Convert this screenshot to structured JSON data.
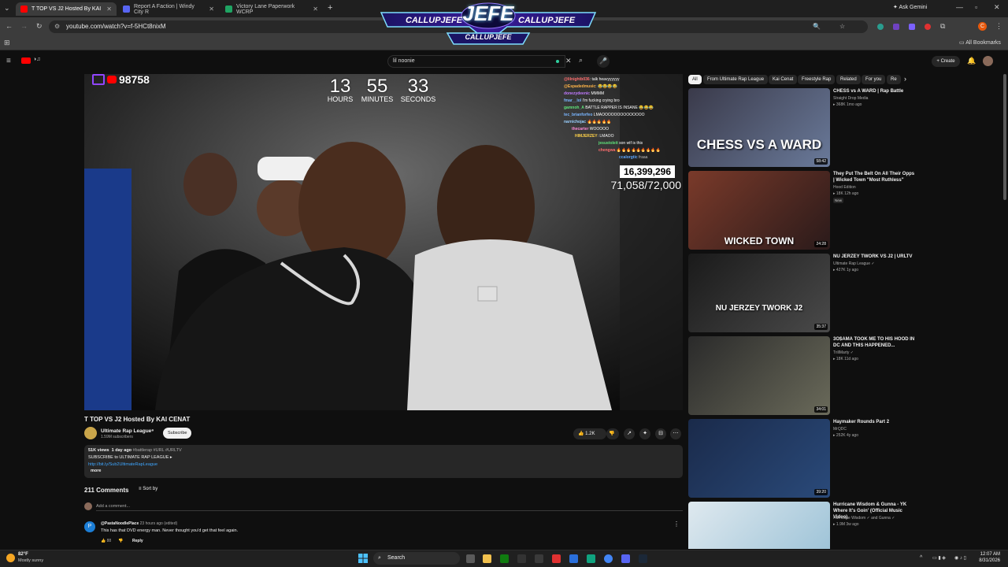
{
  "tabs": [
    {
      "title": "T TOP VS J2 Hosted By KAI",
      "favicon_color": "#ff0000",
      "active": true
    },
    {
      "title": "Report A Faction | Windy City R",
      "favicon_color": "#5865f2",
      "active": false
    },
    {
      "title": "Victory Lane Paperwork WCRP",
      "favicon_color": "#1fa463",
      "active": false
    }
  ],
  "browser": {
    "ask_gemini": "Ask Gemini",
    "url": "youtube.com/watch?v=f-5HCt8nixM",
    "all_bookmarks": "All Bookmarks"
  },
  "banner": {
    "main": "JEFE",
    "left": "CALLUPJEFE",
    "right": "CALLUPJEFE",
    "bottom": "CALLUPJEFE"
  },
  "youtube": {
    "search_value": "lil noonie",
    "create_label": "Create"
  },
  "stream": {
    "viewer_count": "98758",
    "timer": {
      "hours": "13",
      "minutes": "55",
      "seconds": "33",
      "hours_label": "HOURS",
      "minutes_label": "MINUTES",
      "seconds_label": "SECONDS"
    },
    "big_count": "16,399,296",
    "ratio": "71,058/72,000",
    "chat": [
      {
        "user": "@lilnightb036",
        "msg": "talk heavyyyyyy"
      },
      {
        "user": "@Espadedmusic",
        "msg": "😂😂😂😂"
      },
      {
        "user": "donezydeenic",
        "msg": "MMMM"
      },
      {
        "user": "fmar__lol",
        "msg": "I'm fucking crying bro"
      },
      {
        "user": "gamnoh_A",
        "msg": "BATTLE RAPPER IS INSANE 😂😂😂"
      },
      {
        "user": "tec_brianforfeo",
        "msg": "LMAOOOOOOOOOOOOOO"
      },
      {
        "user": "narnichojac",
        "msg": "🔥🔥🔥🔥🔥"
      },
      {
        "user": "thecarter",
        "msg": "WOOOOO"
      },
      {
        "user": "HIMJERZEY",
        "msg": "LMAOO"
      },
      {
        "user": "jesustoleit",
        "msg": "son wtf is this"
      },
      {
        "user": "chengwa",
        "msg": "🔥🔥🔥🔥🔥🔥🔥🔥🔥"
      },
      {
        "user": "ccalorgtic",
        "msg": "fraaa"
      }
    ]
  },
  "video": {
    "title": "T TOP VS J2 Hosted By KAI CENAT",
    "channel": "Ultimate Rap League",
    "subscribers": "1.59M subscribers",
    "subscribe_label": "Subscribe",
    "likes": "1.2K",
    "views": "51K views",
    "age": "1 day ago",
    "tags": "#battlerap #URL #URLTV",
    "desc_line": "SUBSCRIBE to ULTIMATE RAP LEAGUE ▸",
    "link": "http://bit.ly/Sub2UltimateRapLeague",
    "more": "more"
  },
  "comments": {
    "count_label": "211 Comments",
    "sort_label": "Sort by",
    "add_placeholder": "Add a comment...",
    "first": {
      "author": "@PastaNoodlePlace",
      "meta": "23 hours ago (edited)",
      "text": "This has that DVD energy man. Never thought you'd get that feel again.",
      "likes": "88",
      "reply": "Reply"
    }
  },
  "chips": [
    "All",
    "From Ultimate Rap League",
    "Kai Cenat",
    "Freestyle Rap",
    "Related",
    "For you",
    "Re"
  ],
  "recommendations": [
    {
      "title": "CHESS vs A WARD | Rap Battle",
      "channel": "Straight Drop Media",
      "meta": "▸ 368K  1mo ago",
      "duration": "58:42",
      "thumb_text": "CHESS VS A WARD",
      "color1": "#3a3a4a",
      "color2": "#6a7a9a"
    },
    {
      "title": "They Put The Belt On All Their Opps | Wicked Town \"Most Ruthless\"",
      "channel": "Hood Edition",
      "meta": "▸ 18K  12h ago",
      "badge": "New",
      "duration": "24:28",
      "thumb_text": "WICKED TOWN",
      "color1": "#7a3a2a",
      "color2": "#2a1a1a"
    },
    {
      "title": "NU JERZEY TWORK VS J2 | URLTV",
      "channel": "Ultimate Rap League ✓",
      "meta": "▸ 427K  1y ago",
      "duration": "35:37",
      "thumb_text": "NU JERZEY TWORK J2",
      "color1": "#1a1a1a",
      "color2": "#4a4a4a"
    },
    {
      "title": "3O$AMA TOOK ME TO HIS HOOD IN DC AND THIS HAPPENED...",
      "channel": "TrillMarty ✓",
      "meta": "▸ 18K  11d ago",
      "duration": "34:01",
      "thumb_text": "",
      "color1": "#2a2a2a",
      "color2": "#6a6a5a"
    },
    {
      "title": "Haymaker Rounds Part 2",
      "channel": "MrQDC",
      "meta": "▸ 252K  4y ago",
      "duration": "39:20",
      "thumb_text": "",
      "color1": "#1a2a4a",
      "color2": "#2a4a7a"
    },
    {
      "title": "Hurricane Wisdom & Gunna - YK Where It's Goin' (Official Music Video)",
      "channel": "Hurricane Wisdom ✓ and Gunna ✓",
      "meta": "▸ 1.9M  3w ago",
      "duration": "",
      "thumb_text": "",
      "color1": "#dfe9ef",
      "color2": "#9fc4d8"
    }
  ],
  "taskbar": {
    "weather_temp": "82°F",
    "weather_desc": "Mostly sunny",
    "search_label": "Search",
    "time": "12:07 AM",
    "date": "8/31/2026"
  }
}
